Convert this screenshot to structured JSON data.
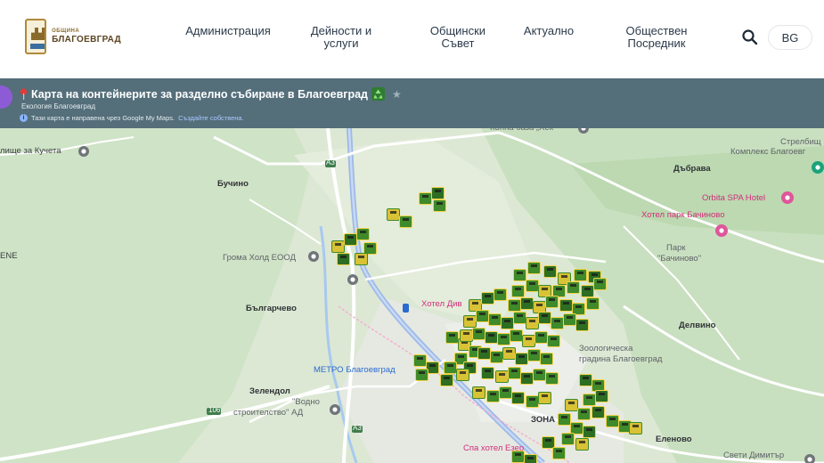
{
  "header": {
    "logo": {
      "line1": "ОБЩИНА",
      "line2": "БЛАГОЕВГРАД"
    },
    "nav": [
      {
        "label": "Администрация"
      },
      {
        "label": "Дейности и\nуслуги"
      },
      {
        "label": "Общински\nСъвет"
      },
      {
        "label": "Актуално"
      },
      {
        "label": "Обществен\nПосредник"
      }
    ],
    "search_icon": "search-icon",
    "lang_label": "BG"
  },
  "map": {
    "title": "Карта на контейнерите за разделно събиране в Благоевград",
    "title_icons": [
      "pin-icon",
      "recycle-icon",
      "star-icon"
    ],
    "author": "Екология Благоевград",
    "info_text": "Тази карта е направена чрез Google My Maps.",
    "info_link": "Създайте собствена.",
    "labels": [
      {
        "text": "Конна база „Хек“"
      },
      {
        "text": "лище за Кучета"
      },
      {
        "text": "Стрелбищ"
      },
      {
        "text": "Комплекс Благоевг"
      },
      {
        "text": "Бучино"
      },
      {
        "text": "Дъбрава"
      },
      {
        "text": "Orbita SPA Hotel"
      },
      {
        "text": "Хотел парк Бачиново"
      },
      {
        "text": "Парк"
      },
      {
        "text": "\"Бачиново\""
      },
      {
        "text": "ENE"
      },
      {
        "text": "Грома Холд ЕООД"
      },
      {
        "text": "Хотел Див"
      },
      {
        "text": "Българчево"
      },
      {
        "text": "Делвино"
      },
      {
        "text": "Зоологическа"
      },
      {
        "text": "градина Благоевград"
      },
      {
        "text": "МЕТРО Благоевград"
      },
      {
        "text": "Зелендол"
      },
      {
        "text": "\"Водно"
      },
      {
        "text": "строителство\" АД"
      },
      {
        "text": "ЗОНА"
      },
      {
        "text": "Спа хотел Езер"
      },
      {
        "text": "Еленово"
      },
      {
        "text": "Свети Димитър"
      },
      {
        "text": "A3"
      },
      {
        "text": "106"
      }
    ]
  },
  "colors": {
    "titlebar": "#546e7a",
    "map_land": "#dfe9d8",
    "road_main": "#ffffff",
    "road_highway": "#9db9e6",
    "marker_green": "#3f8a2a",
    "marker_yellow": "#d8c235"
  }
}
